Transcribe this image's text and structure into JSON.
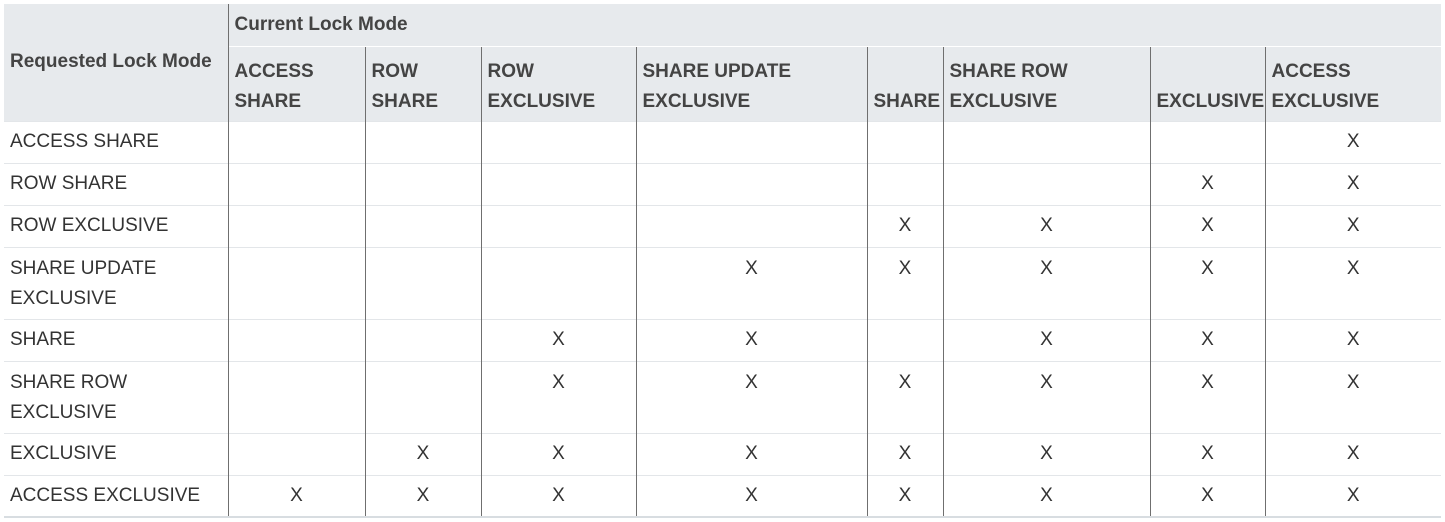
{
  "table": {
    "corner_label": "Requested Lock Mode",
    "group_label": "Current Lock Mode",
    "columns": [
      "ACCESS SHARE",
      "ROW SHARE",
      "ROW EXCLUSIVE",
      "SHARE UPDATE EXCLUSIVE",
      "SHARE",
      "SHARE ROW EXCLUSIVE",
      "EXCLUSIVE",
      "ACCESS EXCLUSIVE"
    ],
    "rows": [
      {
        "label": "ACCESS SHARE",
        "cells": [
          "",
          "",
          "",
          "",
          "",
          "",
          "",
          "X"
        ]
      },
      {
        "label": "ROW SHARE",
        "cells": [
          "",
          "",
          "",
          "",
          "",
          "",
          "X",
          "X"
        ]
      },
      {
        "label": "ROW EXCLUSIVE",
        "cells": [
          "",
          "",
          "",
          "",
          "X",
          "X",
          "X",
          "X"
        ]
      },
      {
        "label": "SHARE UPDATE EXCLUSIVE",
        "cells": [
          "",
          "",
          "",
          "X",
          "X",
          "X",
          "X",
          "X"
        ]
      },
      {
        "label": "SHARE",
        "cells": [
          "",
          "",
          "X",
          "X",
          "",
          "X",
          "X",
          "X"
        ]
      },
      {
        "label": "SHARE ROW EXCLUSIVE",
        "cells": [
          "",
          "",
          "X",
          "X",
          "X",
          "X",
          "X",
          "X"
        ]
      },
      {
        "label": "EXCLUSIVE",
        "cells": [
          "",
          "X",
          "X",
          "X",
          "X",
          "X",
          "X",
          "X"
        ]
      },
      {
        "label": "ACCESS EXCLUSIVE",
        "cells": [
          "X",
          "X",
          "X",
          "X",
          "X",
          "X",
          "X",
          "X"
        ]
      }
    ]
  }
}
